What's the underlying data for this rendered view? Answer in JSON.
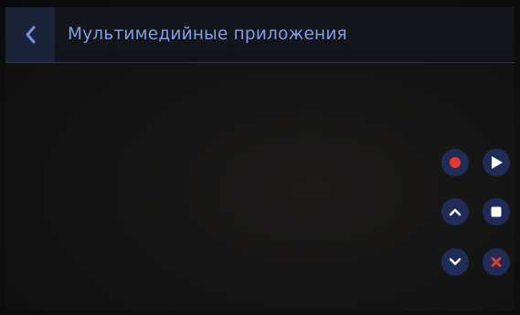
{
  "header": {
    "title": "Мультимедийные приложения",
    "back_icon": "chevron-left-icon"
  },
  "controls": {
    "record_icon": "record-icon",
    "play_icon": "play-icon",
    "up_icon": "chevron-up-icon",
    "stop_icon": "stop-icon",
    "down_icon": "chevron-down-icon",
    "close_icon": "close-icon"
  },
  "colors": {
    "title_text": "#7f9fe8",
    "button_bg": "#1f2c57",
    "record": "#e8392f",
    "close": "#e8392f",
    "icon_white": "#ffffff"
  }
}
